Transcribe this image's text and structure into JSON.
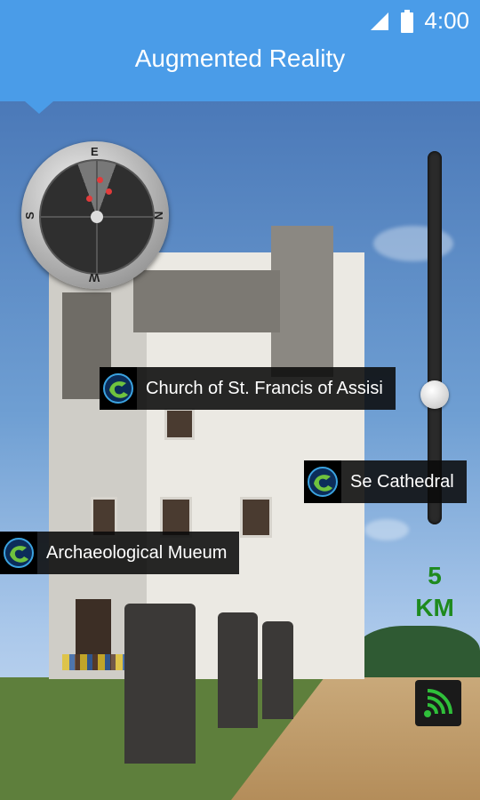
{
  "status_bar": {
    "time": "4:00",
    "icons": [
      "signal-icon",
      "battery-icon"
    ]
  },
  "app_bar": {
    "title": "Augmented Reality",
    "color": "#4a9ce8"
  },
  "compass": {
    "labels": {
      "north": "N",
      "south": "S",
      "east": "E",
      "west": "W"
    },
    "nearby_marker_color": "#e23b3b"
  },
  "distance": {
    "value": "5",
    "unit": "KM",
    "color": "#1e8a1e"
  },
  "pois": [
    {
      "name": "Church of St. Francis of Assisi",
      "icon": "poi-logo-icon"
    },
    {
      "name": "Se Cathedral",
      "icon": "poi-logo-icon"
    },
    {
      "name": "Archaeological Mueum",
      "icon": "poi-logo-icon"
    }
  ],
  "controls": {
    "signal_button_icon": "broadcast-icon"
  }
}
